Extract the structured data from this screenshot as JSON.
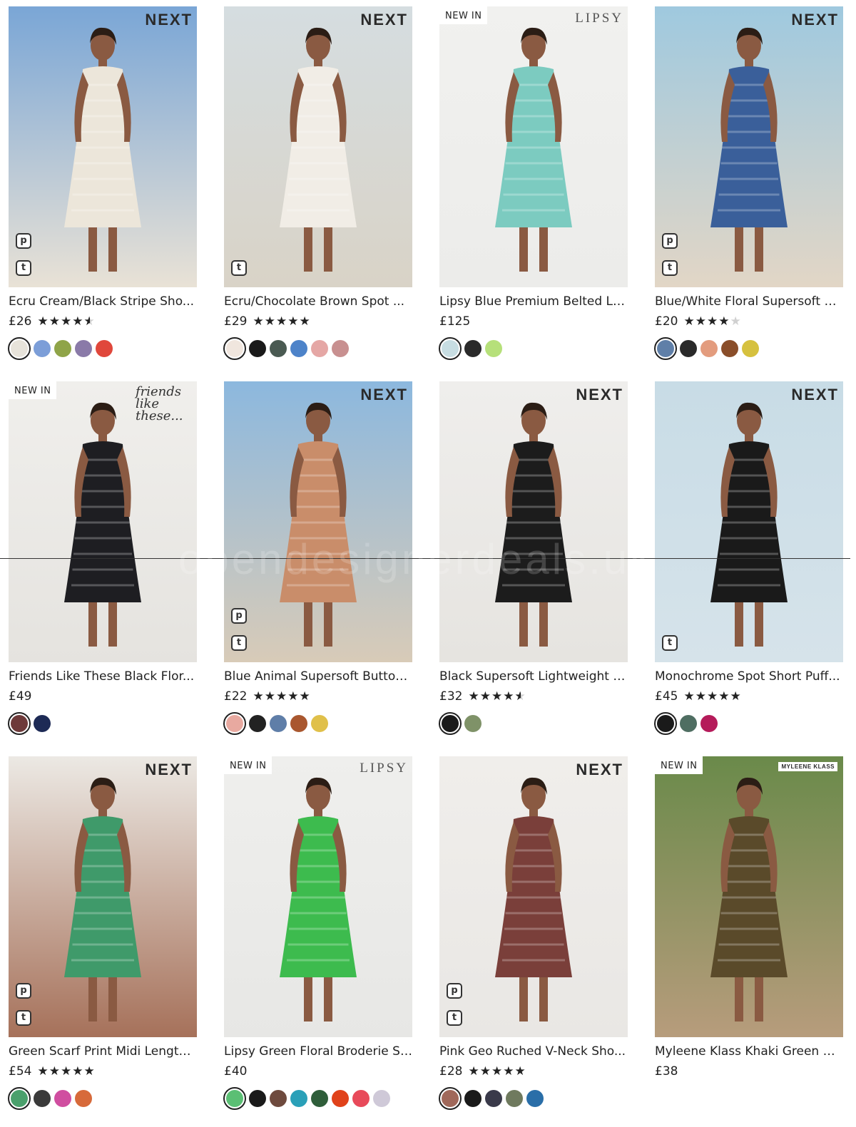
{
  "products": [
    {
      "title": "Ecru Cream/Black Stripe Sho...",
      "price": "£26",
      "rating": 4.5,
      "brand": "NEXT",
      "new_in": "",
      "badges": [
        "p",
        "t"
      ],
      "bg": [
        "#7aa6d6",
        "#e9e2d6"
      ],
      "dress": "#ece6da",
      "swatches": [
        "#e7e3da",
        "#7c9ed8",
        "#8fa448",
        "#8a7aa8",
        "#e0473b"
      ]
    },
    {
      "title": "Ecru/Chocolate Brown Spot ...",
      "price": "£29",
      "rating": 5,
      "brand": "NEXT",
      "new_in": "",
      "badges": [
        "t"
      ],
      "bg": [
        "#d5dde0",
        "#d9d3c7"
      ],
      "dress": "#f1ede6",
      "swatches": [
        "#f0e6de",
        "#1a1a1a",
        "#4a5a52",
        "#4d83c9",
        "#e5a7a5",
        "#c89090"
      ]
    },
    {
      "title": "Lipsy Blue Premium Belted La...",
      "price": "£125",
      "rating": 0,
      "brand": "LIPSY",
      "new_in": "NEW IN",
      "badges": [],
      "bg": [
        "#f1f1ef",
        "#ececea"
      ],
      "dress": "#7ccbc0",
      "swatches": [
        "#c7dde2",
        "#2a2a2a",
        "#b6e07a"
      ]
    },
    {
      "title": "Blue/White Floral Supersoft B...",
      "price": "£20",
      "rating": 4,
      "brand": "NEXT",
      "new_in": "",
      "badges": [
        "p",
        "t"
      ],
      "bg": [
        "#9fc9df",
        "#e2d6c6"
      ],
      "dress": "#3a5f9a",
      "swatches": [
        "#5f7fa8",
        "#2a2a2a",
        "#e39c7e",
        "#8a4e2a",
        "#d6c13f"
      ]
    },
    {
      "title": "Friends Like These Black Flor...",
      "price": "£49",
      "rating": 0,
      "brand": "friends like these...",
      "new_in": "NEW IN",
      "badges": [],
      "bg": [
        "#f0efec",
        "#e5e3df"
      ],
      "dress": "#1e1e22",
      "swatches": [
        "#6e3a3a",
        "#1d2a55"
      ]
    },
    {
      "title": "Blue Animal Supersoft Button...",
      "price": "£22",
      "rating": 5,
      "brand": "NEXT",
      "new_in": "",
      "badges": [
        "p",
        "t"
      ],
      "bg": [
        "#8cb8de",
        "#d8cbb8"
      ],
      "dress": "#c98d6a",
      "swatches": [
        "#e8a9a0",
        "#222222",
        "#5f7ea8",
        "#a9572f",
        "#e0c04a"
      ]
    },
    {
      "title": "Black Supersoft Lightweight L...",
      "price": "£32",
      "rating": 4.5,
      "brand": "NEXT",
      "new_in": "",
      "badges": [],
      "bg": [
        "#efeeec",
        "#e6e4e0"
      ],
      "dress": "#1c1c1c",
      "swatches": [
        "#1a1a1a",
        "#7f9268"
      ]
    },
    {
      "title": "Monochrome Spot Short Puff...",
      "price": "£45",
      "rating": 5,
      "brand": "NEXT",
      "new_in": "",
      "badges": [
        "t"
      ],
      "bg": [
        "#c8dce6",
        "#d6e3ea"
      ],
      "dress": "#1a1a1a",
      "swatches": [
        "#1a1a1a",
        "#4f6e62",
        "#b51b5a"
      ]
    },
    {
      "title": "Green Scarf Print Midi Length...",
      "price": "£54",
      "rating": 5,
      "brand": "NEXT",
      "new_in": "",
      "badges": [
        "p",
        "t"
      ],
      "bg": [
        "#ece9e4",
        "#a6715a"
      ],
      "dress": "#3f9a6a",
      "swatches": [
        "#4aa06c",
        "#3a3a3a",
        "#d04ea0",
        "#d76a3a"
      ]
    },
    {
      "title": "Lipsy Green Floral Broderie Sl...",
      "price": "£40",
      "rating": 0,
      "brand": "LIPSY",
      "new_in": "NEW IN",
      "badges": [],
      "bg": [
        "#efefed",
        "#e7e7e5"
      ],
      "dress": "#3dbb4e",
      "swatches": [
        "#5bbf74",
        "#1a1a1a",
        "#6e4a3e",
        "#2aa0b8",
        "#2f5e3a",
        "#e0421a",
        "#e84a5a",
        "#cfc9d8"
      ]
    },
    {
      "title": "Pink Geo Ruched V-Neck Sho...",
      "price": "£28",
      "rating": 5,
      "brand": "NEXT",
      "new_in": "",
      "badges": [
        "p",
        "t"
      ],
      "bg": [
        "#f0eeeb",
        "#e9e7e4"
      ],
      "dress": "#7a3f3a",
      "swatches": [
        "#a0685a",
        "#1a1a1a",
        "#3a3a4a",
        "#6f7a5e",
        "#2a6ea8"
      ]
    },
    {
      "title": "Myleene Klass Khaki Green M...",
      "price": "£38",
      "rating": 0,
      "brand": "MYLEENE KLASS",
      "new_in": "NEW IN",
      "badges": [],
      "bg": [
        "#6a8a4a",
        "#b79c7c"
      ],
      "dress": "#5a4a2a",
      "swatches": []
    }
  ],
  "watermark": "opendesignerdeals.uk"
}
